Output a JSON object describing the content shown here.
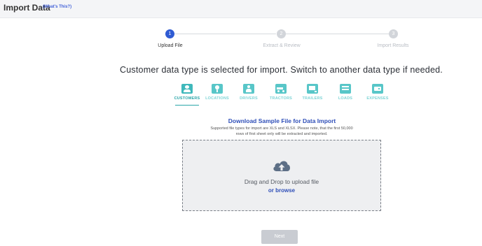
{
  "header": {
    "title": "Import Data",
    "help_link": "(What's This?)"
  },
  "stepper": {
    "steps": [
      {
        "number": "1",
        "label": "Upload File",
        "state": "active"
      },
      {
        "number": "2",
        "label": "Extract & Review",
        "state": "inactive"
      },
      {
        "number": "3",
        "label": "Import Results",
        "state": "inactive"
      }
    ]
  },
  "main": {
    "headline": "Customer data type is selected for import. Switch to another data type if needed.",
    "data_types": [
      {
        "label": "CUSTOMERS",
        "icon": "customer-card-icon",
        "selected": true
      },
      {
        "label": "LOCATIONS",
        "icon": "map-pin-icon",
        "selected": false
      },
      {
        "label": "DRIVERS",
        "icon": "driver-person-icon",
        "selected": false
      },
      {
        "label": "TRACTORS",
        "icon": "tractor-truck-icon",
        "selected": false
      },
      {
        "label": "TRAILERS",
        "icon": "trailer-icon",
        "selected": false
      },
      {
        "label": "LOADS",
        "icon": "loads-list-icon",
        "selected": false
      },
      {
        "label": "EXPENSES",
        "icon": "wallet-icon",
        "selected": false
      }
    ],
    "download_link": "Download Sample File for Data Import",
    "note": "Supported file types for import are XLS and XLSX. Please note, that the first 50,000 rows of first sheet only will be extracted and imported.",
    "dropzone": {
      "text": "Drag and Drop to upload file",
      "browse": "or browse"
    },
    "next_button": "Next"
  },
  "colors": {
    "accent_blue": "#2f5bd3",
    "teal": "#58c6c8",
    "teal_dark": "#2aa6a9",
    "link_blue": "#2f4fb8",
    "button_disabled": "#c9ccd2"
  }
}
